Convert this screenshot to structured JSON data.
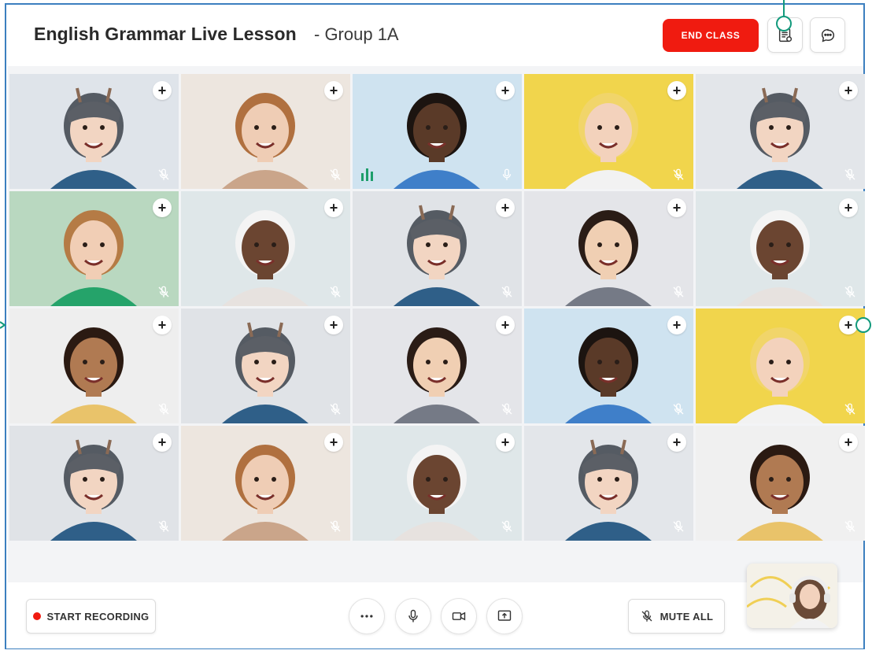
{
  "header": {
    "title": "English Grammar Live Lesson",
    "subtitle": "- Group 1A",
    "end_class_label": "END CLASS"
  },
  "grid": {
    "tiles": [
      {
        "bg": "#dfe4ea",
        "skin": "#f2d5c2",
        "hair": "#555b63",
        "shirt": "#2f5f88",
        "muted": true,
        "hat": true
      },
      {
        "bg": "#ede6df",
        "skin": "#efcdb5",
        "hair": "#b0703f",
        "shirt": "#caa58a",
        "muted": true,
        "hat": false
      },
      {
        "bg": "#cfe3f0",
        "skin": "#5a3a28",
        "hair": "#1c1410",
        "shirt": "#3f7fc9",
        "muted": false,
        "hat": false
      },
      {
        "bg": "#f1d54c",
        "skin": "#f3d2bc",
        "hair": "#f1d56a",
        "shirt": "#f2f2f2",
        "muted": true,
        "hat": false
      },
      {
        "bg": "#e3e6ea",
        "skin": "#f2d5c2",
        "hair": "#555b63",
        "shirt": "#2f5f88",
        "muted": true,
        "hat": true
      },
      {
        "bg": "#b9d8c0",
        "skin": "#f1ceb5",
        "hair": "#b57b45",
        "shirt": "#25a36a",
        "muted": true,
        "hat": false
      },
      {
        "bg": "#dfe7e9",
        "skin": "#6b4531",
        "hair": "#f4f4f4",
        "shirt": "#e7e2df",
        "muted": true,
        "hat": false
      },
      {
        "bg": "#e0e3e7",
        "skin": "#f2d5c2",
        "hair": "#555b63",
        "shirt": "#2f5f88",
        "muted": true,
        "hat": true
      },
      {
        "bg": "#e4e5e9",
        "skin": "#f0cfb3",
        "hair": "#2a1c16",
        "shirt": "#757a86",
        "muted": true,
        "hat": false
      },
      {
        "bg": "#dfe7e9",
        "skin": "#6b4531",
        "hair": "#f4f4f4",
        "shirt": "#e7e2df",
        "muted": true,
        "hat": false
      },
      {
        "bg": "#eeeeee",
        "skin": "#b07a52",
        "hair": "#2b1a12",
        "shirt": "#e9c36a",
        "muted": true,
        "hat": false
      },
      {
        "bg": "#e0e3e7",
        "skin": "#f2d5c2",
        "hair": "#555b63",
        "shirt": "#2f5f88",
        "muted": true,
        "hat": true
      },
      {
        "bg": "#e4e5e9",
        "skin": "#f0cfb3",
        "hair": "#2a1c16",
        "shirt": "#757a86",
        "muted": true,
        "hat": false
      },
      {
        "bg": "#cfe3f0",
        "skin": "#5a3a28",
        "hair": "#1c1410",
        "shirt": "#3f7fc9",
        "muted": true,
        "hat": false
      },
      {
        "bg": "#f1d54c",
        "skin": "#f3d2bc",
        "hair": "#f1d56a",
        "shirt": "#f2f2f2",
        "muted": true,
        "hat": false
      },
      {
        "bg": "#e0e3e7",
        "skin": "#f2d5c2",
        "hair": "#555b63",
        "shirt": "#2f5f88",
        "muted": true,
        "hat": true
      },
      {
        "bg": "#ede6df",
        "skin": "#efcdb5",
        "hair": "#b0703f",
        "shirt": "#caa58a",
        "muted": true,
        "hat": false
      },
      {
        "bg": "#dfe7e9",
        "skin": "#6b4531",
        "hair": "#f4f4f4",
        "shirt": "#e7e2df",
        "muted": true,
        "hat": false
      },
      {
        "bg": "#e3e6ea",
        "skin": "#f2d5c2",
        "hair": "#555b63",
        "shirt": "#2f5f88",
        "muted": true,
        "hat": true
      },
      {
        "bg": "#f0f0f0",
        "skin": "#b07a52",
        "hair": "#2b1a12",
        "shirt": "#e9c36a",
        "muted": true,
        "hat": false
      }
    ]
  },
  "controls": {
    "start_recording_label": "START RECORDING",
    "mute_all_label": "MUTE ALL",
    "icons": [
      "more-icon",
      "microphone-icon",
      "camera-icon",
      "share-screen-icon"
    ]
  },
  "colors": {
    "end_class": "#f01b10",
    "speaking_bars": "#1e9e6b",
    "handle": "#129a7c",
    "frame": "#3c7fbf"
  }
}
